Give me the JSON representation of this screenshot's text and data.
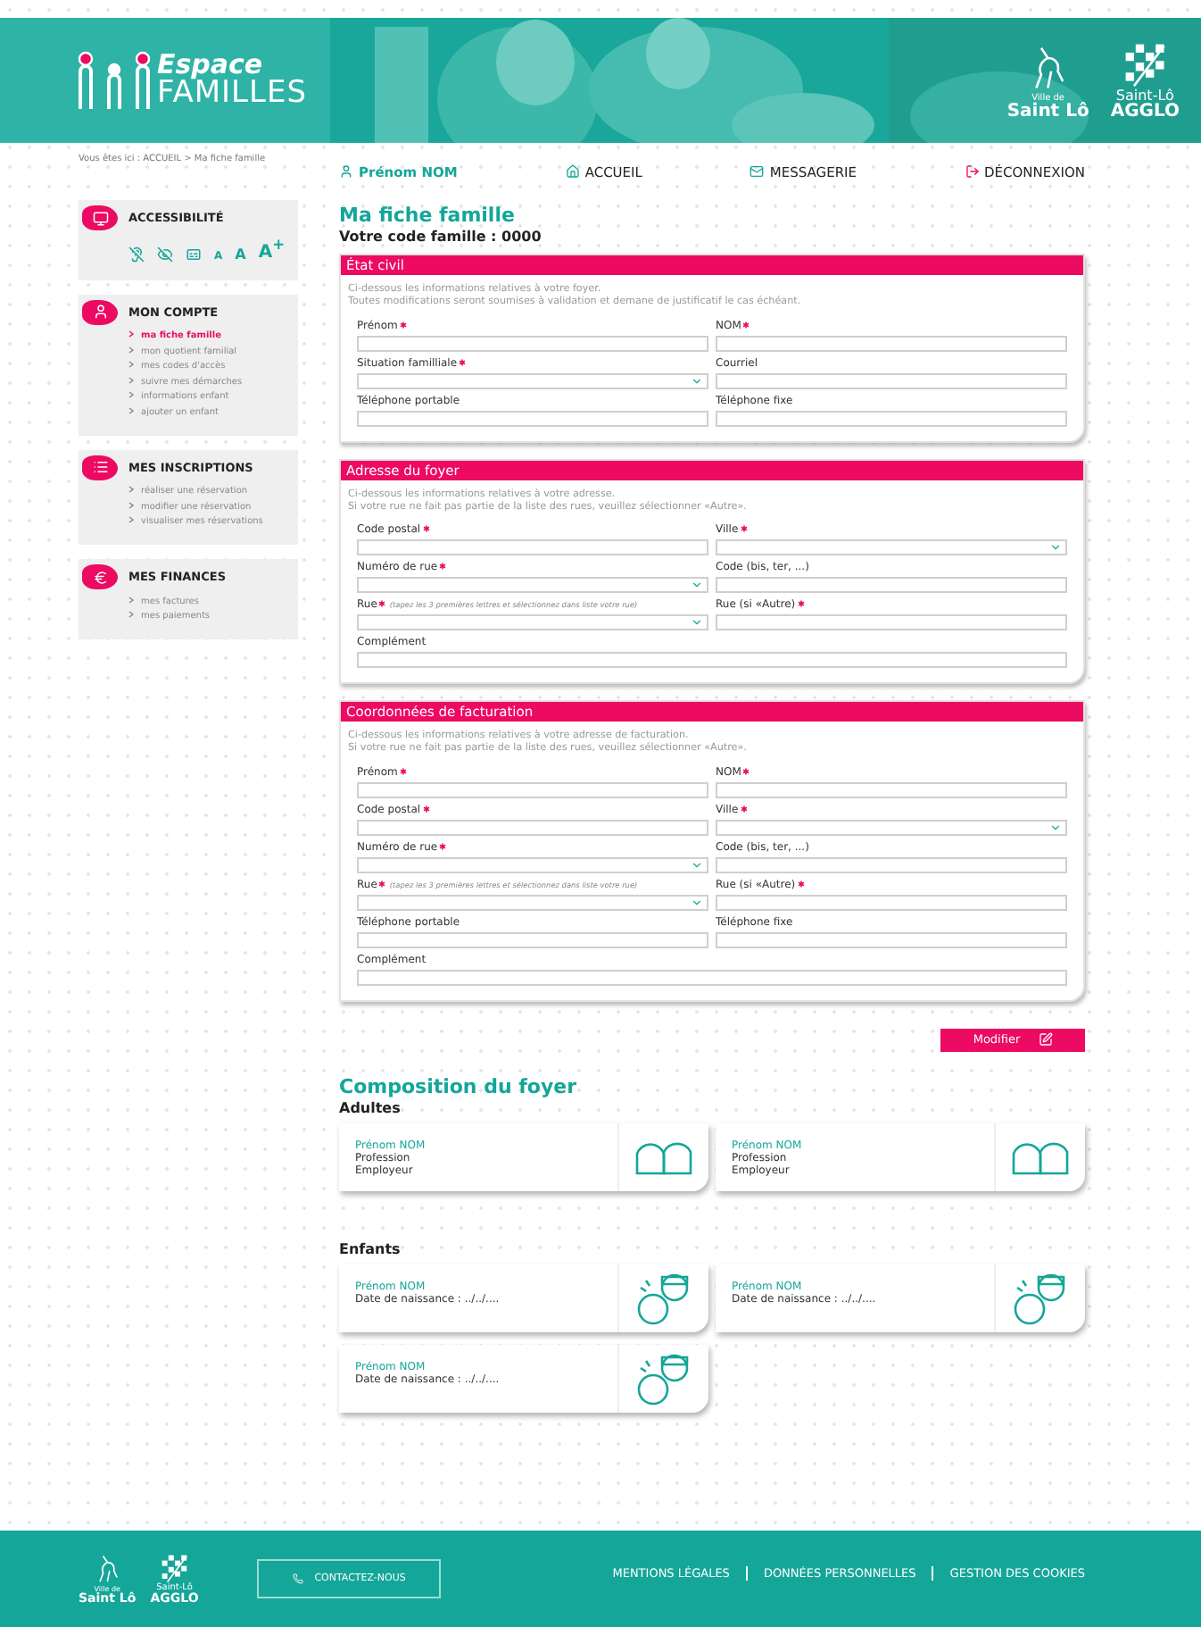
{
  "header": {
    "logo": {
      "line1": "Espace",
      "line2": "FAMILLES"
    },
    "town_logo": {
      "small": "Ville de",
      "name": "Saint Lô"
    },
    "agglo_logo": {
      "line1": "Saint-Lô",
      "line2": "AGGLO"
    }
  },
  "breadcrumb": "Vous êtes ici : ACCUEIL > Ma fiche famille",
  "nav": {
    "user": "Prénom NOM",
    "links": [
      {
        "label": "ACCUEIL"
      },
      {
        "label": "MESSAGERIE"
      },
      {
        "label": "DÉCONNEXION"
      }
    ]
  },
  "sidebar": {
    "accessibility": {
      "title": "ACCESSIBILITÉ",
      "font_sizes": [
        "A",
        "A",
        "A$^{+}$"
      ]
    },
    "panels": [
      {
        "title": "MON COMPTE",
        "items": [
          {
            "label": "ma fiche famille",
            "selected": true
          },
          {
            "label": "mon quotient familial",
            "selected": false
          },
          {
            "label": "mes codes d'accès",
            "selected": false
          },
          {
            "label": "suivre mes démarches",
            "selected": false
          },
          {
            "label": "informations enfant",
            "selected": false
          },
          {
            "label": "ajouter un enfant",
            "selected": false
          }
        ]
      },
      {
        "title": "MES INSCRIPTIONS",
        "items": [
          {
            "label": "réaliser une réservation",
            "selected": false
          },
          {
            "label": "modifier une réservation",
            "selected": false
          },
          {
            "label": "visualiser mes réservations",
            "selected": false
          }
        ]
      },
      {
        "title": "MES FINANCES",
        "items": [
          {
            "label": "mes factures",
            "selected": false
          },
          {
            "label": "mes paiements",
            "selected": false
          }
        ]
      }
    ]
  },
  "page_title": "Ma fiche famille",
  "family_code": "Votre code famille : 0000",
  "sections": [
    {
      "title": "État civil",
      "intro": [
        "Ci-dessous les informations relatives à votre foyer.",
        "Toutes modifications seront soumises à validation et demane de justificatif le cas échéant."
      ],
      "fields": [
        {
          "label": "Prénom",
          "required": true,
          "kind": "text"
        },
        {
          "label": "NOM",
          "required": true,
          "kind": "text"
        },
        {
          "label": "Situation familliale",
          "required": true,
          "kind": "select"
        },
        {
          "label": "Courriel",
          "required": false,
          "kind": "text"
        },
        {
          "label": "Téléphone portable",
          "required": false,
          "kind": "text"
        },
        {
          "label": "Téléphone fixe",
          "required": false,
          "kind": "text"
        }
      ]
    },
    {
      "title": "Adresse du foyer",
      "intro": [
        "Ci-dessous les informations relatives à votre adresse.",
        "Si votre rue ne fait pas partie de la liste des rues, veuillez sélectionner «Autre»."
      ],
      "fields": [
        {
          "label": "Code postal",
          "required": true,
          "kind": "text"
        },
        {
          "label": "Ville",
          "required": true,
          "kind": "select"
        },
        {
          "label": "Numéro de rue",
          "required": true,
          "kind": "select"
        },
        {
          "label": "Code (bis, ter, ...)",
          "required": false,
          "kind": "text"
        },
        {
          "label": "Rue",
          "required": true,
          "hint": "(tapez les 3 premières lettres et sélectionnez dans liste votre rue)",
          "kind": "select"
        },
        {
          "label": "Rue (si «Autre)",
          "required": true,
          "kind": "text"
        },
        {
          "label": "Complément",
          "required": false,
          "kind": "wide"
        }
      ]
    },
    {
      "title": "Coordonnées de facturation",
      "intro": [
        "Ci-dessous les informations relatives à votre adresse de facturation.",
        "Si votre rue ne fait pas partie de la liste des rues, veuillez sélectionner «Autre»."
      ],
      "fields": [
        {
          "label": "Prénom",
          "required": true,
          "kind": "text"
        },
        {
          "label": "NOM",
          "required": true,
          "kind": "text"
        },
        {
          "label": "Code postal",
          "required": true,
          "kind": "text"
        },
        {
          "label": "Ville",
          "required": true,
          "kind": "select"
        },
        {
          "label": "Numéro de rue",
          "required": true,
          "kind": "select"
        },
        {
          "label": "Code (bis, ter, ...)",
          "required": false,
          "kind": "text"
        },
        {
          "label": "Rue",
          "required": true,
          "hint": "(tapez les 3 premières lettres et sélectionnez dans liste votre rue)",
          "kind": "select"
        },
        {
          "label": "Rue (si «Autre)",
          "required": true,
          "kind": "text"
        },
        {
          "label": "Téléphone portable",
          "required": false,
          "kind": "text"
        },
        {
          "label": "Téléphone fixe",
          "required": false,
          "kind": "text"
        },
        {
          "label": "Complément",
          "required": false,
          "kind": "wide"
        }
      ]
    }
  ],
  "modify_button": "Modifier",
  "composition": {
    "title": "Composition du foyer",
    "groups": [
      {
        "title": "Adultes",
        "kind": "adult",
        "members": [
          {
            "name": "Prénom NOM",
            "lines": [
              "Profession",
              "Employeur"
            ]
          },
          {
            "name": "Prénom NOM",
            "lines": [
              "Profession",
              "Employeur"
            ]
          }
        ]
      },
      {
        "title": "Enfants",
        "kind": "child",
        "members": [
          {
            "name": "Prénom NOM",
            "lines": [
              "Date de naissance : ../../...."
            ]
          },
          {
            "name": "Prénom NOM",
            "lines": [
              "Date de naissance : ../../...."
            ]
          },
          {
            "name": "Prénom NOM",
            "lines": [
              "Date de naissance : ../../...."
            ]
          }
        ]
      }
    ]
  },
  "footer": {
    "town_logo": {
      "small": "Ville de",
      "name": "Saint Lô"
    },
    "agglo_logo": {
      "line1": "Saint-Lô",
      "line2": "AGGLO"
    },
    "contact_button": "CONTACTEZ-NOUS",
    "links": [
      "MENTIONS LÉGALES",
      "DONNÉES PERSONNELLES",
      "GESTION DES COOKIES"
    ]
  }
}
